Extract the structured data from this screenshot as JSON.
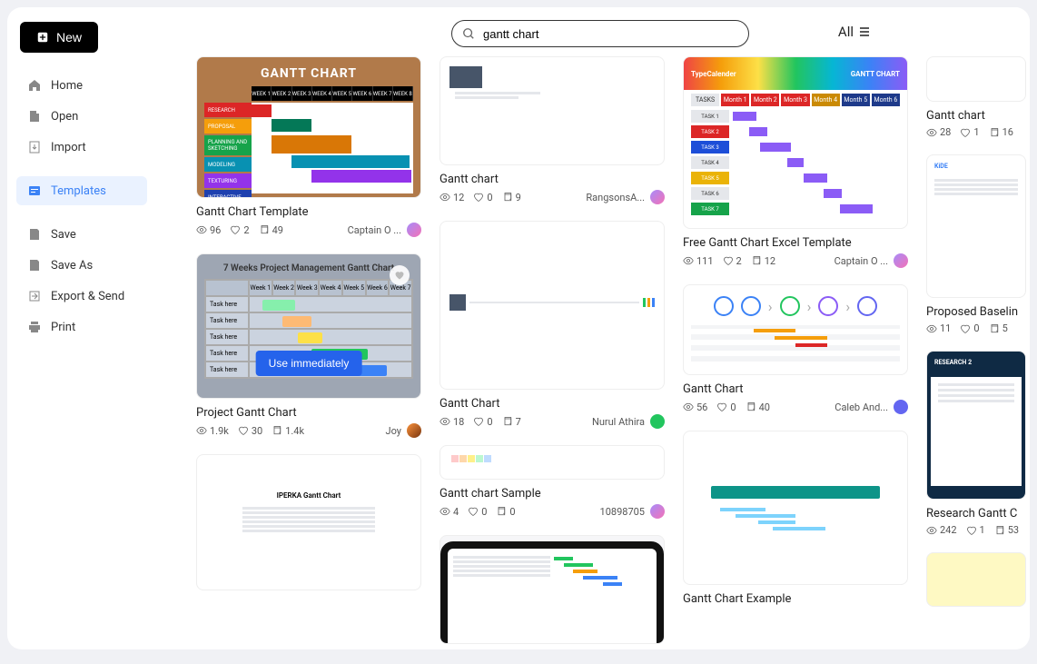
{
  "new_button": "New",
  "nav": {
    "home": "Home",
    "open": "Open",
    "import": "Import",
    "templates": "Templates",
    "save": "Save",
    "save_as": "Save As",
    "export": "Export & Send",
    "print": "Print"
  },
  "search": {
    "value": "gantt chart",
    "placeholder": "Search"
  },
  "filter": "All",
  "use_immediately": "Use immediately",
  "cards": {
    "c1": {
      "title": "Gantt Chart Template",
      "views": "96",
      "likes": "2",
      "copies": "49",
      "author": "Captain O ..."
    },
    "c2": {
      "title": "Project Gantt Chart",
      "views": "1.9k",
      "likes": "30",
      "copies": "1.4k",
      "author": "Joy"
    },
    "c3": {
      "title": "Gantt chart",
      "views": "12",
      "likes": "0",
      "copies": "9",
      "author": "RangsonsA..."
    },
    "c4": {
      "title": "Gantt Chart",
      "views": "18",
      "likes": "0",
      "copies": "7",
      "author": "Nurul Athira"
    },
    "c5": {
      "title": "Gantt chart Sample",
      "views": "4",
      "likes": "0",
      "copies": "0",
      "author": "10898705"
    },
    "c6": {
      "title": "Free Gantt Chart Excel Template",
      "views": "111",
      "likes": "2",
      "copies": "12",
      "author": "Captain O ..."
    },
    "c7": {
      "title": "Gantt Chart",
      "views": "56",
      "likes": "0",
      "copies": "40",
      "author": "Caleb And..."
    },
    "c8": {
      "title": "Gantt Chart Example"
    },
    "c9": {
      "title": "Gantt chart",
      "views": "28",
      "likes": "1",
      "copies": "16"
    },
    "c10": {
      "title": "Proposed Baselin",
      "views": "11",
      "likes": "0",
      "copies": "5"
    },
    "c11": {
      "title": "Research Gantt C",
      "views": "242",
      "likes": "1",
      "copies": "53"
    }
  },
  "thumb_labels": {
    "t1_title": "GANTT CHART",
    "t1_weeks": [
      "WEEK 1",
      "WEEK 2",
      "WEEK 3",
      "WEEK 4",
      "WEEK 5",
      "WEEK 6",
      "WEEK 7",
      "WEEK 8"
    ],
    "t1_rows": [
      "RESEARCH",
      "PROPOSAL",
      "PLANNING AND SKETCHING",
      "MODELING",
      "TEXTURING",
      "INTERACTIVE"
    ],
    "t2_title": "7 Weeks Project Management Gantt Chart",
    "t5_brand": "TypeCalender",
    "t5_title": "GANTT CHART",
    "t5_months": [
      "Month 1",
      "Month 2",
      "Month 3",
      "Month 4",
      "Month 5",
      "Month 6"
    ],
    "t5_tasks_header": "TASKS",
    "iperka": "IPERKA Gantt Chart",
    "research2": "RESEARCH 2"
  }
}
